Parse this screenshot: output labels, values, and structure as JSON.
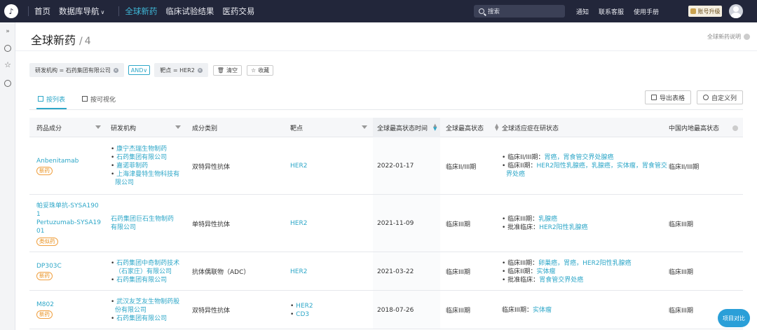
{
  "nav": {
    "items": [
      "首页",
      "数据库导航",
      "全球新药",
      "临床试验结果",
      "医药交易"
    ],
    "search_placeholder": "搜索",
    "links": [
      "通知",
      "联系客服",
      "使用手册"
    ],
    "upgrade": "账号升级"
  },
  "page": {
    "title": "全球新药",
    "count_sep": "/",
    "count": "4",
    "explain": "全球新药说明"
  },
  "filters": {
    "org": "研发机构 = 石药集团有限公司",
    "op": "AND",
    "target": "靶点 = HER2",
    "clear": "清空",
    "favorite": "收藏"
  },
  "tabs": {
    "list": "按列表",
    "visual": "按可视化"
  },
  "actions": {
    "export": "导出表格",
    "custom": "自定义列"
  },
  "columns": [
    "药品成分",
    "研发机构",
    "成分类别",
    "靶点",
    "全球最高状态时间",
    "全球最高状态",
    "全球适应症在研状态",
    "中国内地最高状态"
  ],
  "rows": [
    {
      "drug": [
        "Anbenitamab"
      ],
      "tag": "新药",
      "orgs": [
        "康宁杰瑞生物制药",
        "石药集团有限公司",
        "嘉诺菲制药",
        "上海津曼特生物科技有",
        "限公司"
      ],
      "type": "双特异性抗体",
      "targets": [
        "HER2"
      ],
      "date": "2022-01-17",
      "status": "临床II/III期",
      "indications": [
        {
          "label": "临床II/III期：",
          "value": "胃癌，胃食管交界处腺癌"
        },
        {
          "label": "临床II期：",
          "value": "HER2阳性乳腺癌，乳腺癌，实体瘤，胃食管交"
        },
        {
          "label": "",
          "value": "界处癌"
        }
      ],
      "cn_status": "临床II/III期"
    },
    {
      "drug": [
        "帕妥珠单抗-SYSA190",
        "1",
        "Pertuzumab-SYSA19",
        "01"
      ],
      "tag": "类似药",
      "orgs": [
        "石药集团巨石生物制药",
        "有限公司"
      ],
      "type": "单特异性抗体",
      "targets": [
        "HER2"
      ],
      "date": "2021-11-09",
      "status": "临床III期",
      "indications": [
        {
          "label": "临床III期：",
          "value": "乳腺癌"
        },
        {
          "label": "批准临床：",
          "value": "HER2阳性乳腺癌"
        }
      ],
      "cn_status": "临床III期"
    },
    {
      "drug": [
        "DP303C"
      ],
      "tag": "新药",
      "orgs": [
        "石药集团中奇制药技术",
        "（石家庄）有限公司",
        "石药集团有限公司"
      ],
      "type": "抗体偶联物（ADC）",
      "targets": [
        "HER2"
      ],
      "date": "2021-03-22",
      "status": "临床III期",
      "indications": [
        {
          "label": "临床III期：",
          "value": "卵巢癌，胃癌，HER2阳性乳腺癌"
        },
        {
          "label": "临床II期：",
          "value": "实体瘤"
        },
        {
          "label": "批准临床：",
          "value": "胃食管交界处癌"
        }
      ],
      "cn_status": "临床III期"
    },
    {
      "drug": [
        "M802"
      ],
      "tag": "新药",
      "orgs": [
        "武汉友芝友生物制药股",
        "份有限公司",
        "石药集团有限公司"
      ],
      "type": "双特异性抗体",
      "targets": [
        "HER2",
        "CD3"
      ],
      "date": "2018-07-26",
      "status": "临床III期",
      "indications": [
        {
          "label": "临床III期：",
          "value": "实体瘤"
        }
      ],
      "cn_status": "临床III期"
    }
  ],
  "compare": "项目对比"
}
